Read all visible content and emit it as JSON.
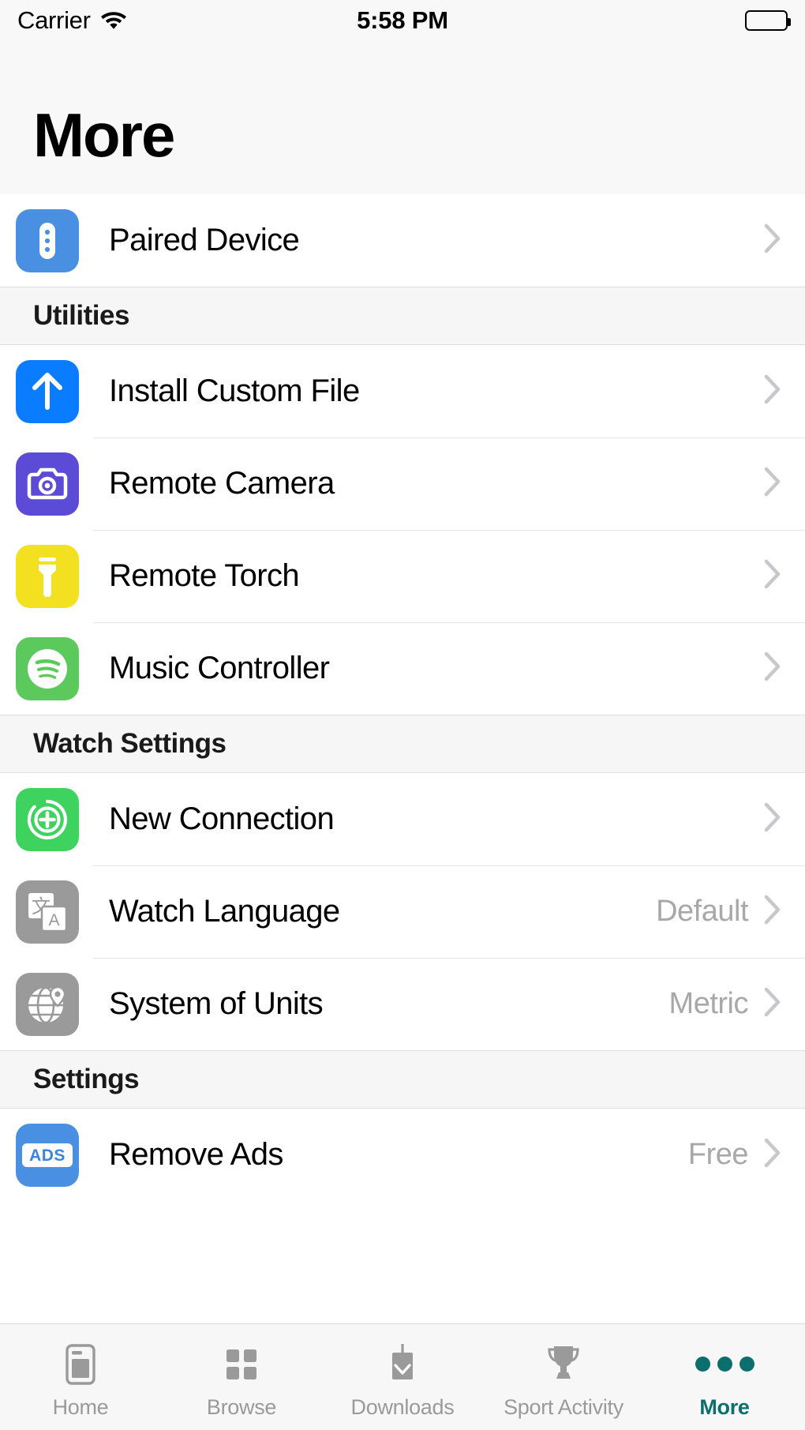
{
  "status_bar": {
    "carrier": "Carrier",
    "wifi_icon": "wifi-icon",
    "time": "5:58 PM",
    "battery_icon": "battery-full-icon"
  },
  "header": {
    "title": "More"
  },
  "colors": {
    "accent_active_tab": "#0d6e6e",
    "paired_device_icon_bg": "#4a90e2",
    "install_custom_file_icon_bg": "#0a7cff",
    "remote_camera_icon_bg": "#5b4bd6",
    "remote_torch_icon_bg": "#f2e021",
    "music_controller_icon_bg": "#5cc95c",
    "new_connection_icon_bg": "#3ed35e",
    "watch_language_icon_bg": "#9a9a9a",
    "system_of_units_icon_bg": "#9a9a9a",
    "remove_ads_icon_bg": "#4a90e2",
    "row_value_text": "#a8a8a8",
    "chevron": "#c7c7cc"
  },
  "sections": [
    {
      "header": null,
      "rows": [
        {
          "label": "Paired Device",
          "icon": "paired-device-icon",
          "value": null,
          "chevron": true
        }
      ]
    },
    {
      "header": "Utilities",
      "rows": [
        {
          "label": "Install Custom File",
          "icon": "upload-arrow-icon",
          "value": null,
          "chevron": true
        },
        {
          "label": "Remote Camera",
          "icon": "camera-icon",
          "value": null,
          "chevron": true
        },
        {
          "label": "Remote Torch",
          "icon": "flashlight-icon",
          "value": null,
          "chevron": true
        },
        {
          "label": "Music Controller",
          "icon": "spotify-music-icon",
          "value": null,
          "chevron": true
        }
      ]
    },
    {
      "header": "Watch Settings",
      "rows": [
        {
          "label": "New Connection",
          "icon": "plus-circle-icon",
          "value": null,
          "chevron": true
        },
        {
          "label": "Watch Language",
          "icon": "translate-icon",
          "value": "Default",
          "chevron": true
        },
        {
          "label": "System of Units",
          "icon": "globe-pin-icon",
          "value": "Metric",
          "chevron": true
        }
      ]
    },
    {
      "header": "Settings",
      "rows": [
        {
          "label": "Remove Ads",
          "icon": "ads-badge-icon",
          "value": "Free",
          "chevron": true
        }
      ]
    }
  ],
  "tab_bar": {
    "tabs": [
      {
        "label": "Home",
        "icon": "device-home-icon",
        "active": false
      },
      {
        "label": "Browse",
        "icon": "grid-squares-icon",
        "active": false
      },
      {
        "label": "Downloads",
        "icon": "download-arrow-icon",
        "active": false
      },
      {
        "label": "Sport Activity",
        "icon": "trophy-icon",
        "active": false
      },
      {
        "label": "More",
        "icon": "three-dots-icon",
        "active": true
      }
    ]
  }
}
